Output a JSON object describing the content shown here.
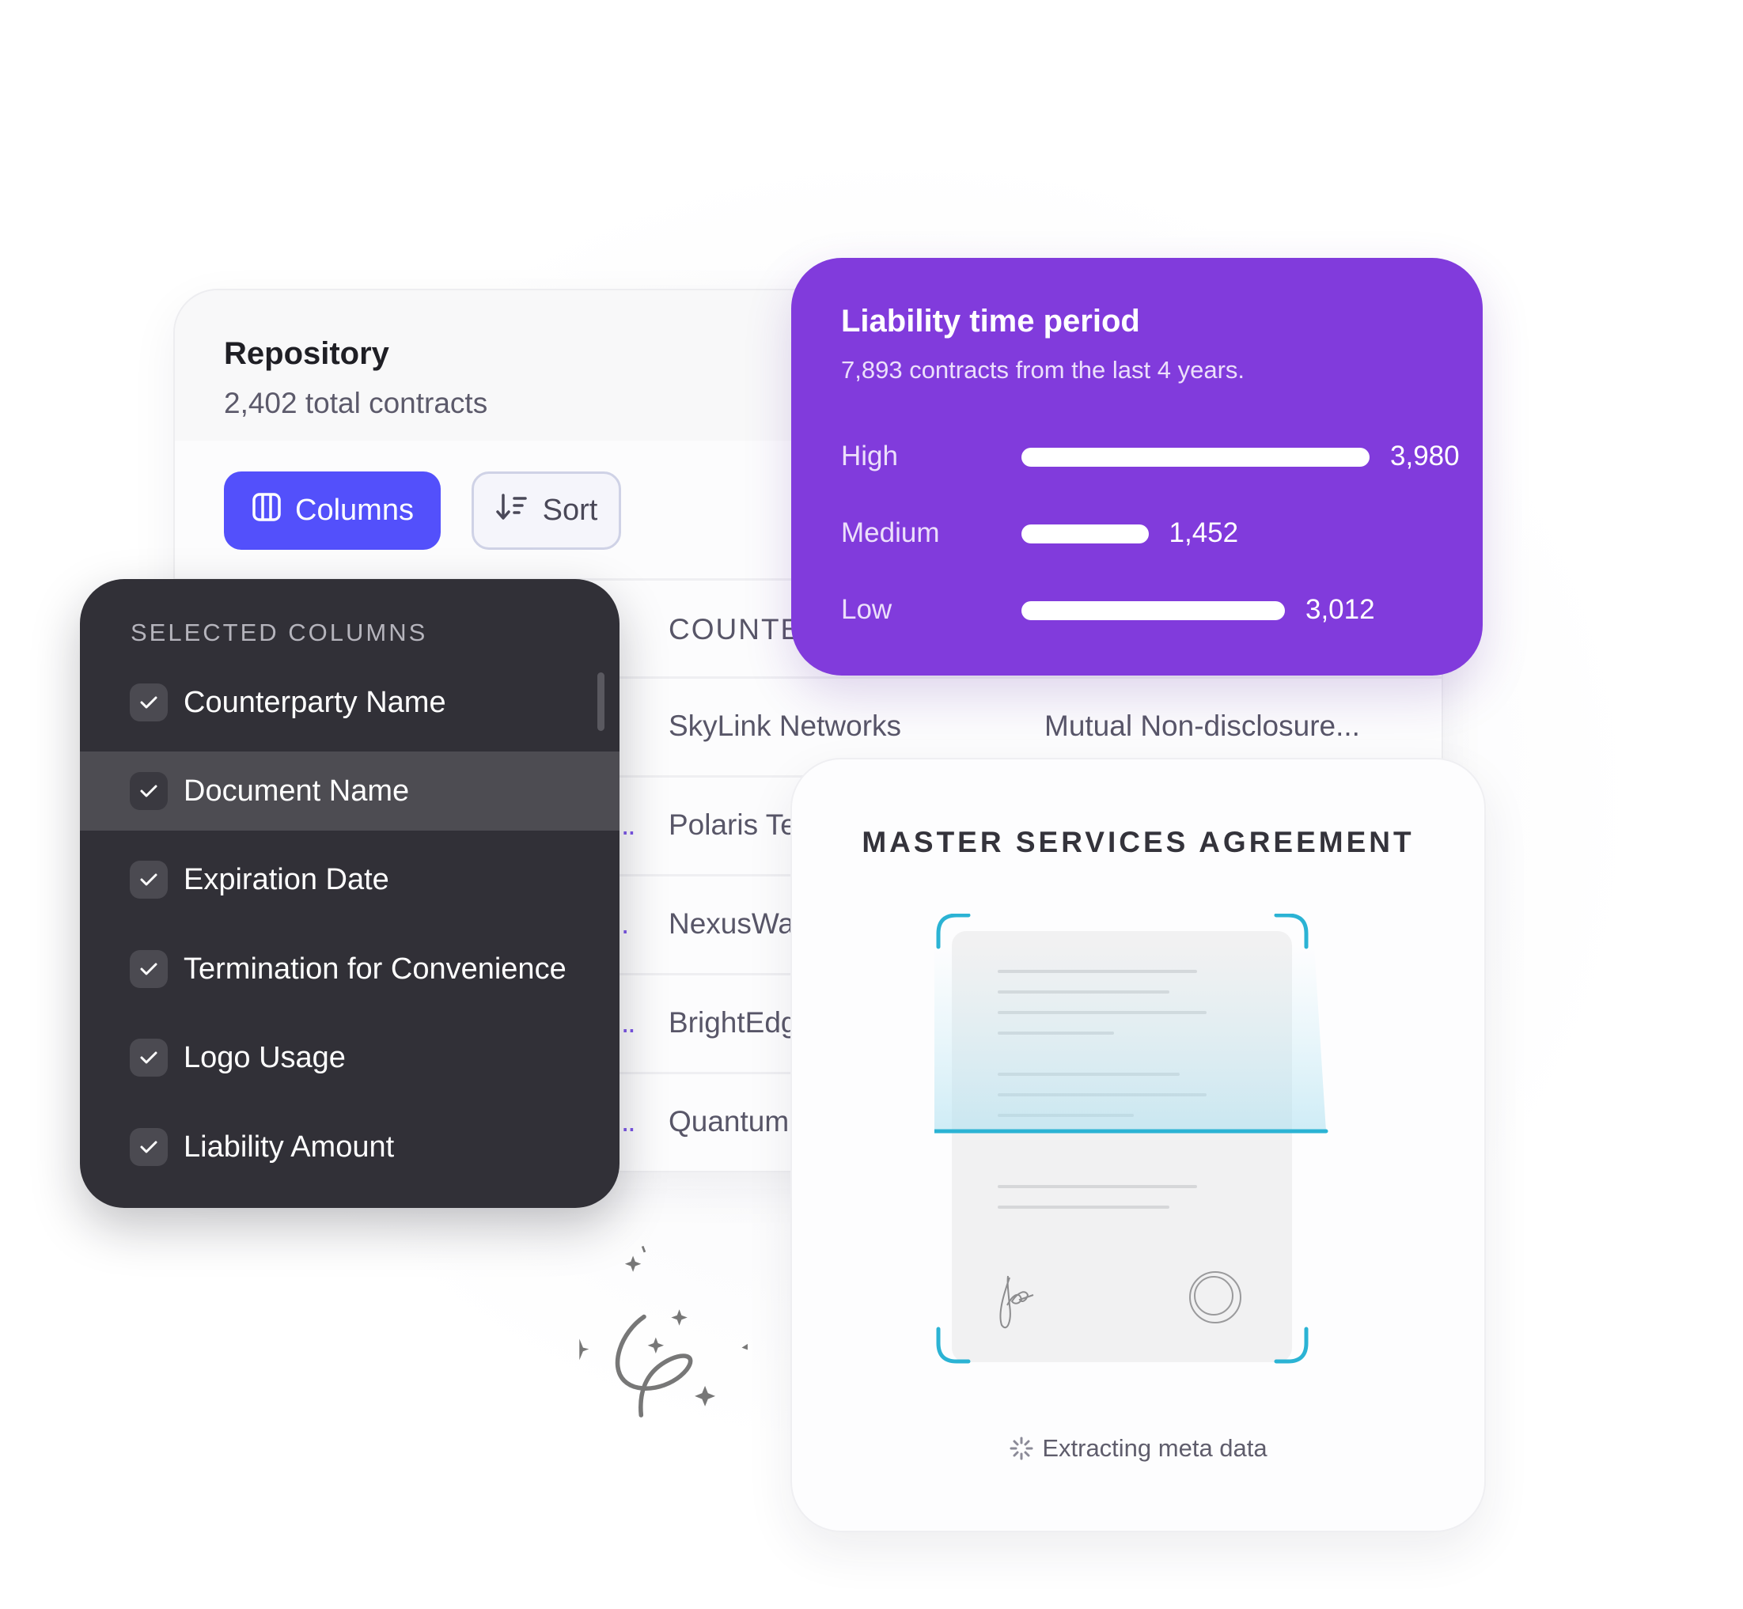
{
  "repository": {
    "title": "Repository",
    "subtitle": "2,402 total contracts",
    "columns_button": "Columns",
    "sort_button": "Sort",
    "table": {
      "header": "COUNTE",
      "rows": [
        {
          "counterparty": "SkyLink Networks",
          "document": "Mutual Non-disclosure...",
          "prefix": ""
        },
        {
          "counterparty": "Polaris Te",
          "document": "",
          "prefix": ".."
        },
        {
          "counterparty": "NexusWa",
          "document": "",
          "prefix": "."
        },
        {
          "counterparty": "BrightEdg",
          "document": "",
          "prefix": ".."
        },
        {
          "counterparty": "Quantum",
          "document": "",
          "prefix": ".."
        }
      ]
    }
  },
  "selected_columns": {
    "title": "SELECTED COLUMNS",
    "items": [
      {
        "label": "Counterparty Name",
        "checked": true,
        "highlighted": false
      },
      {
        "label": "Document Name",
        "checked": true,
        "highlighted": true
      },
      {
        "label": "Expiration Date",
        "checked": true,
        "highlighted": false
      },
      {
        "label": "Termination for Convenience",
        "checked": true,
        "highlighted": false
      },
      {
        "label": "Logo Usage",
        "checked": true,
        "highlighted": false
      },
      {
        "label": "Liability Amount",
        "checked": true,
        "highlighted": false
      }
    ]
  },
  "liability": {
    "title": "Liability time period",
    "subtitle": "7,893 contracts from the last 4 years.",
    "rows": [
      {
        "label": "High",
        "value": 3980,
        "display": "3,980"
      },
      {
        "label": "Medium",
        "value": 1452,
        "display": "1,452"
      },
      {
        "label": "Low",
        "value": 3012,
        "display": "3,012"
      }
    ]
  },
  "msa": {
    "title": "MASTER SERVICES AGREEMENT",
    "status": "Extracting meta data",
    "status_icon": "loading-spinner-icon",
    "scan_color": "#2bb3d4"
  },
  "colors": {
    "primary": "#5350fb",
    "purple_card": "#813bdc",
    "dark_panel": "#313037"
  }
}
